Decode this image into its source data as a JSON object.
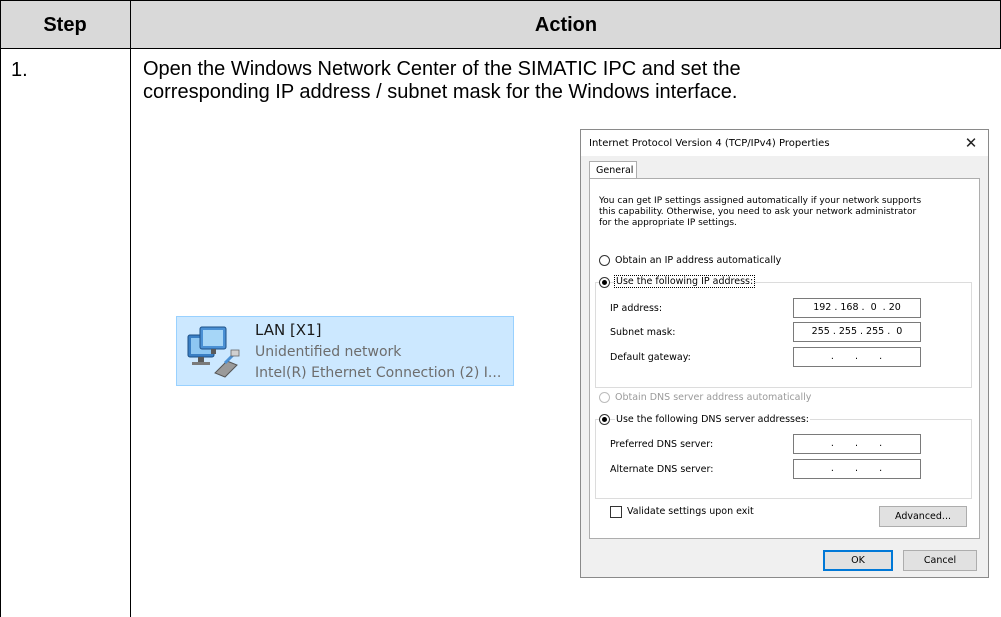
{
  "table": {
    "col_step": "Step",
    "col_action": "Action",
    "step_number": "1.",
    "instruction_line1": "Open the Windows Network Center of the SIMATIC IPC and set the",
    "instruction_line2": "corresponding IP address / subnet mask for the Windows interface."
  },
  "adapter": {
    "name": "LAN [X1]",
    "status": "Unidentified network",
    "device": "Intel(R) Ethernet Connection (2) I...",
    "icon": "network-adapter-icon"
  },
  "dialog": {
    "title": "Internet Protocol Version 4 (TCP/IPv4) Properties",
    "close_glyph": "✕",
    "tab_general": "General",
    "description_line1": "You can get IP settings assigned automatically if your network supports",
    "description_line2": "this capability. Otherwise, you need to ask your network administrator",
    "description_line3": "for the appropriate IP settings.",
    "ip_auto_label": "Obtain an IP address automatically",
    "ip_manual_label": "Use the following IP address:",
    "ip_address_label": "IP address:",
    "ip_address_value": "192 . 168 .  0  . 20",
    "subnet_label": "Subnet mask:",
    "subnet_value": "255 . 255 . 255 .  0",
    "gateway_label": "Default gateway:",
    "gateway_value": " .     .     . ",
    "dns_auto_label": "Obtain DNS server address automatically",
    "dns_manual_label": "Use the following DNS server addresses:",
    "preferred_dns_label": "Preferred DNS server:",
    "preferred_dns_value": " .     .     . ",
    "alternate_dns_label": "Alternate DNS server:",
    "alternate_dns_value": " .     .     . ",
    "validate_label": "Validate settings upon exit",
    "validate_checked": false,
    "advanced_button": "Advanced...",
    "ok_button": "OK",
    "cancel_button": "Cancel",
    "ip_mode_selected": "manual",
    "dns_mode_selected": "manual"
  },
  "colors": {
    "header_bg": "#d9d9d9",
    "adapter_highlight": "#cce8ff",
    "default_button_border": "#0078d7"
  }
}
